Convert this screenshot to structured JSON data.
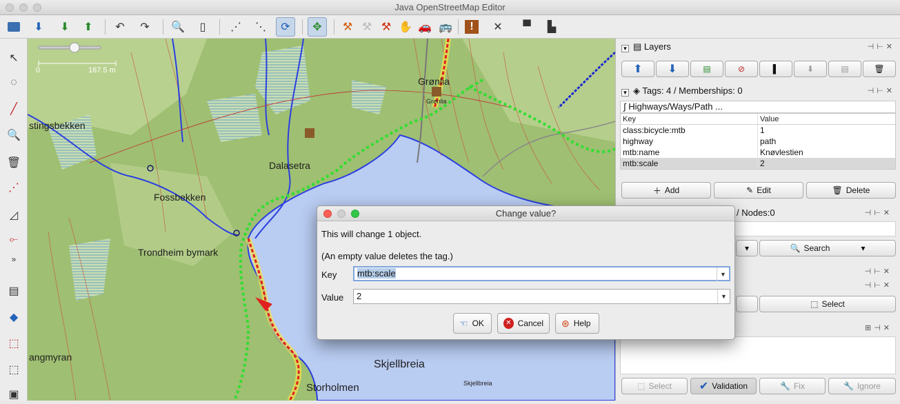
{
  "window": {
    "title": "Java OpenStreetMap Editor"
  },
  "map": {
    "scale_label_start": "0",
    "scale_label_end": "167.5 m",
    "places": [
      {
        "name": "Grønlia",
        "size": "big"
      },
      {
        "name": "Grønlia",
        "size": "tiny"
      },
      {
        "name": "stingsbekken",
        "size": "big"
      },
      {
        "name": "Dalasetra",
        "size": "big"
      },
      {
        "name": "Fossbekken",
        "size": "big"
      },
      {
        "name": "Trondheim bymark",
        "size": "big"
      },
      {
        "name": "angmyran",
        "size": "big"
      },
      {
        "name": "Skjellbreia",
        "size": "big"
      },
      {
        "name": "Skjellbreia",
        "size": "tiny"
      },
      {
        "name": "Storholmen",
        "size": "big"
      }
    ]
  },
  "layers_panel": {
    "title": "Layers"
  },
  "tags_panel": {
    "title": "Tags: 4 / Memberships: 0",
    "selection": "Highways/Ways/Path ...",
    "col_key": "Key",
    "col_value": "Value",
    "rows": [
      {
        "key": "class:bicycle:mtb",
        "value": "1"
      },
      {
        "key": "highway",
        "value": "path"
      },
      {
        "key": "mtb:name",
        "value": "Knøvlestien"
      },
      {
        "key": "mtb:scale",
        "value": "2"
      }
    ],
    "add_label": "Add",
    "edit_label": "Edit",
    "delete_label": "Delete"
  },
  "selection_panel": {
    "title_fragment": "/ Nodes:0",
    "search_label": "Search",
    "select_label": "Select"
  },
  "validation_panel": {
    "select_label": "Select",
    "validation_label": "Validation",
    "fix_label": "Fix",
    "ignore_label": "Ignore"
  },
  "dialog": {
    "title": "Change value?",
    "message": "This will change 1 object.",
    "note": "(An empty value deletes the tag.)",
    "key_label": "Key",
    "key_value": "mtb:scale",
    "value_label": "Value",
    "value_value": "2",
    "ok_label": "OK",
    "cancel_label": "Cancel",
    "help_label": "Help"
  },
  "colors": {
    "water": "#b9ccf2",
    "forest": "#9fbf72",
    "highlight": "#b5cde9",
    "track_green": "#33dd33",
    "track_red": "#e02020",
    "river_blue": "#2a3fe0"
  }
}
